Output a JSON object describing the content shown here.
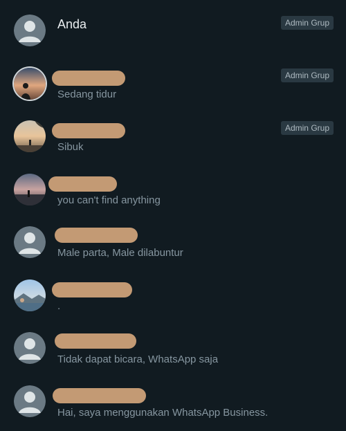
{
  "participants": [
    {
      "name": "Anda",
      "status": "",
      "badge": "Admin Grup",
      "avatar": "default-avatar-icon"
    },
    {
      "name": "",
      "status": "Sedang tidur",
      "badge": "Admin Grup",
      "avatar": "sunset-silhouette-photo"
    },
    {
      "name": "",
      "status": "Sibuk",
      "badge": "Admin Grup",
      "avatar": "beach-sunset-photo"
    },
    {
      "name": "",
      "status": "you can't find anything",
      "badge": "",
      "avatar": "dusk-beach-photo"
    },
    {
      "name": "",
      "status": "Male parta, Male dilabuntur",
      "badge": "",
      "avatar": "default-avatar-icon"
    },
    {
      "name": "",
      "status": ".",
      "badge": "",
      "avatar": "mountain-lake-photo"
    },
    {
      "name": "",
      "status": "Tidak dapat bicara, WhatsApp saja",
      "badge": "",
      "avatar": "default-avatar-icon"
    },
    {
      "name": "",
      "status": "Hai, saya menggunakan WhatsApp Business.",
      "badge": "",
      "avatar": "default-avatar-icon"
    }
  ],
  "colors": {
    "background": "#111b21",
    "primary_text": "#e9edef",
    "secondary_text": "#8696a0",
    "badge_bg": "#2a3942",
    "redaction": "#c39a74"
  }
}
